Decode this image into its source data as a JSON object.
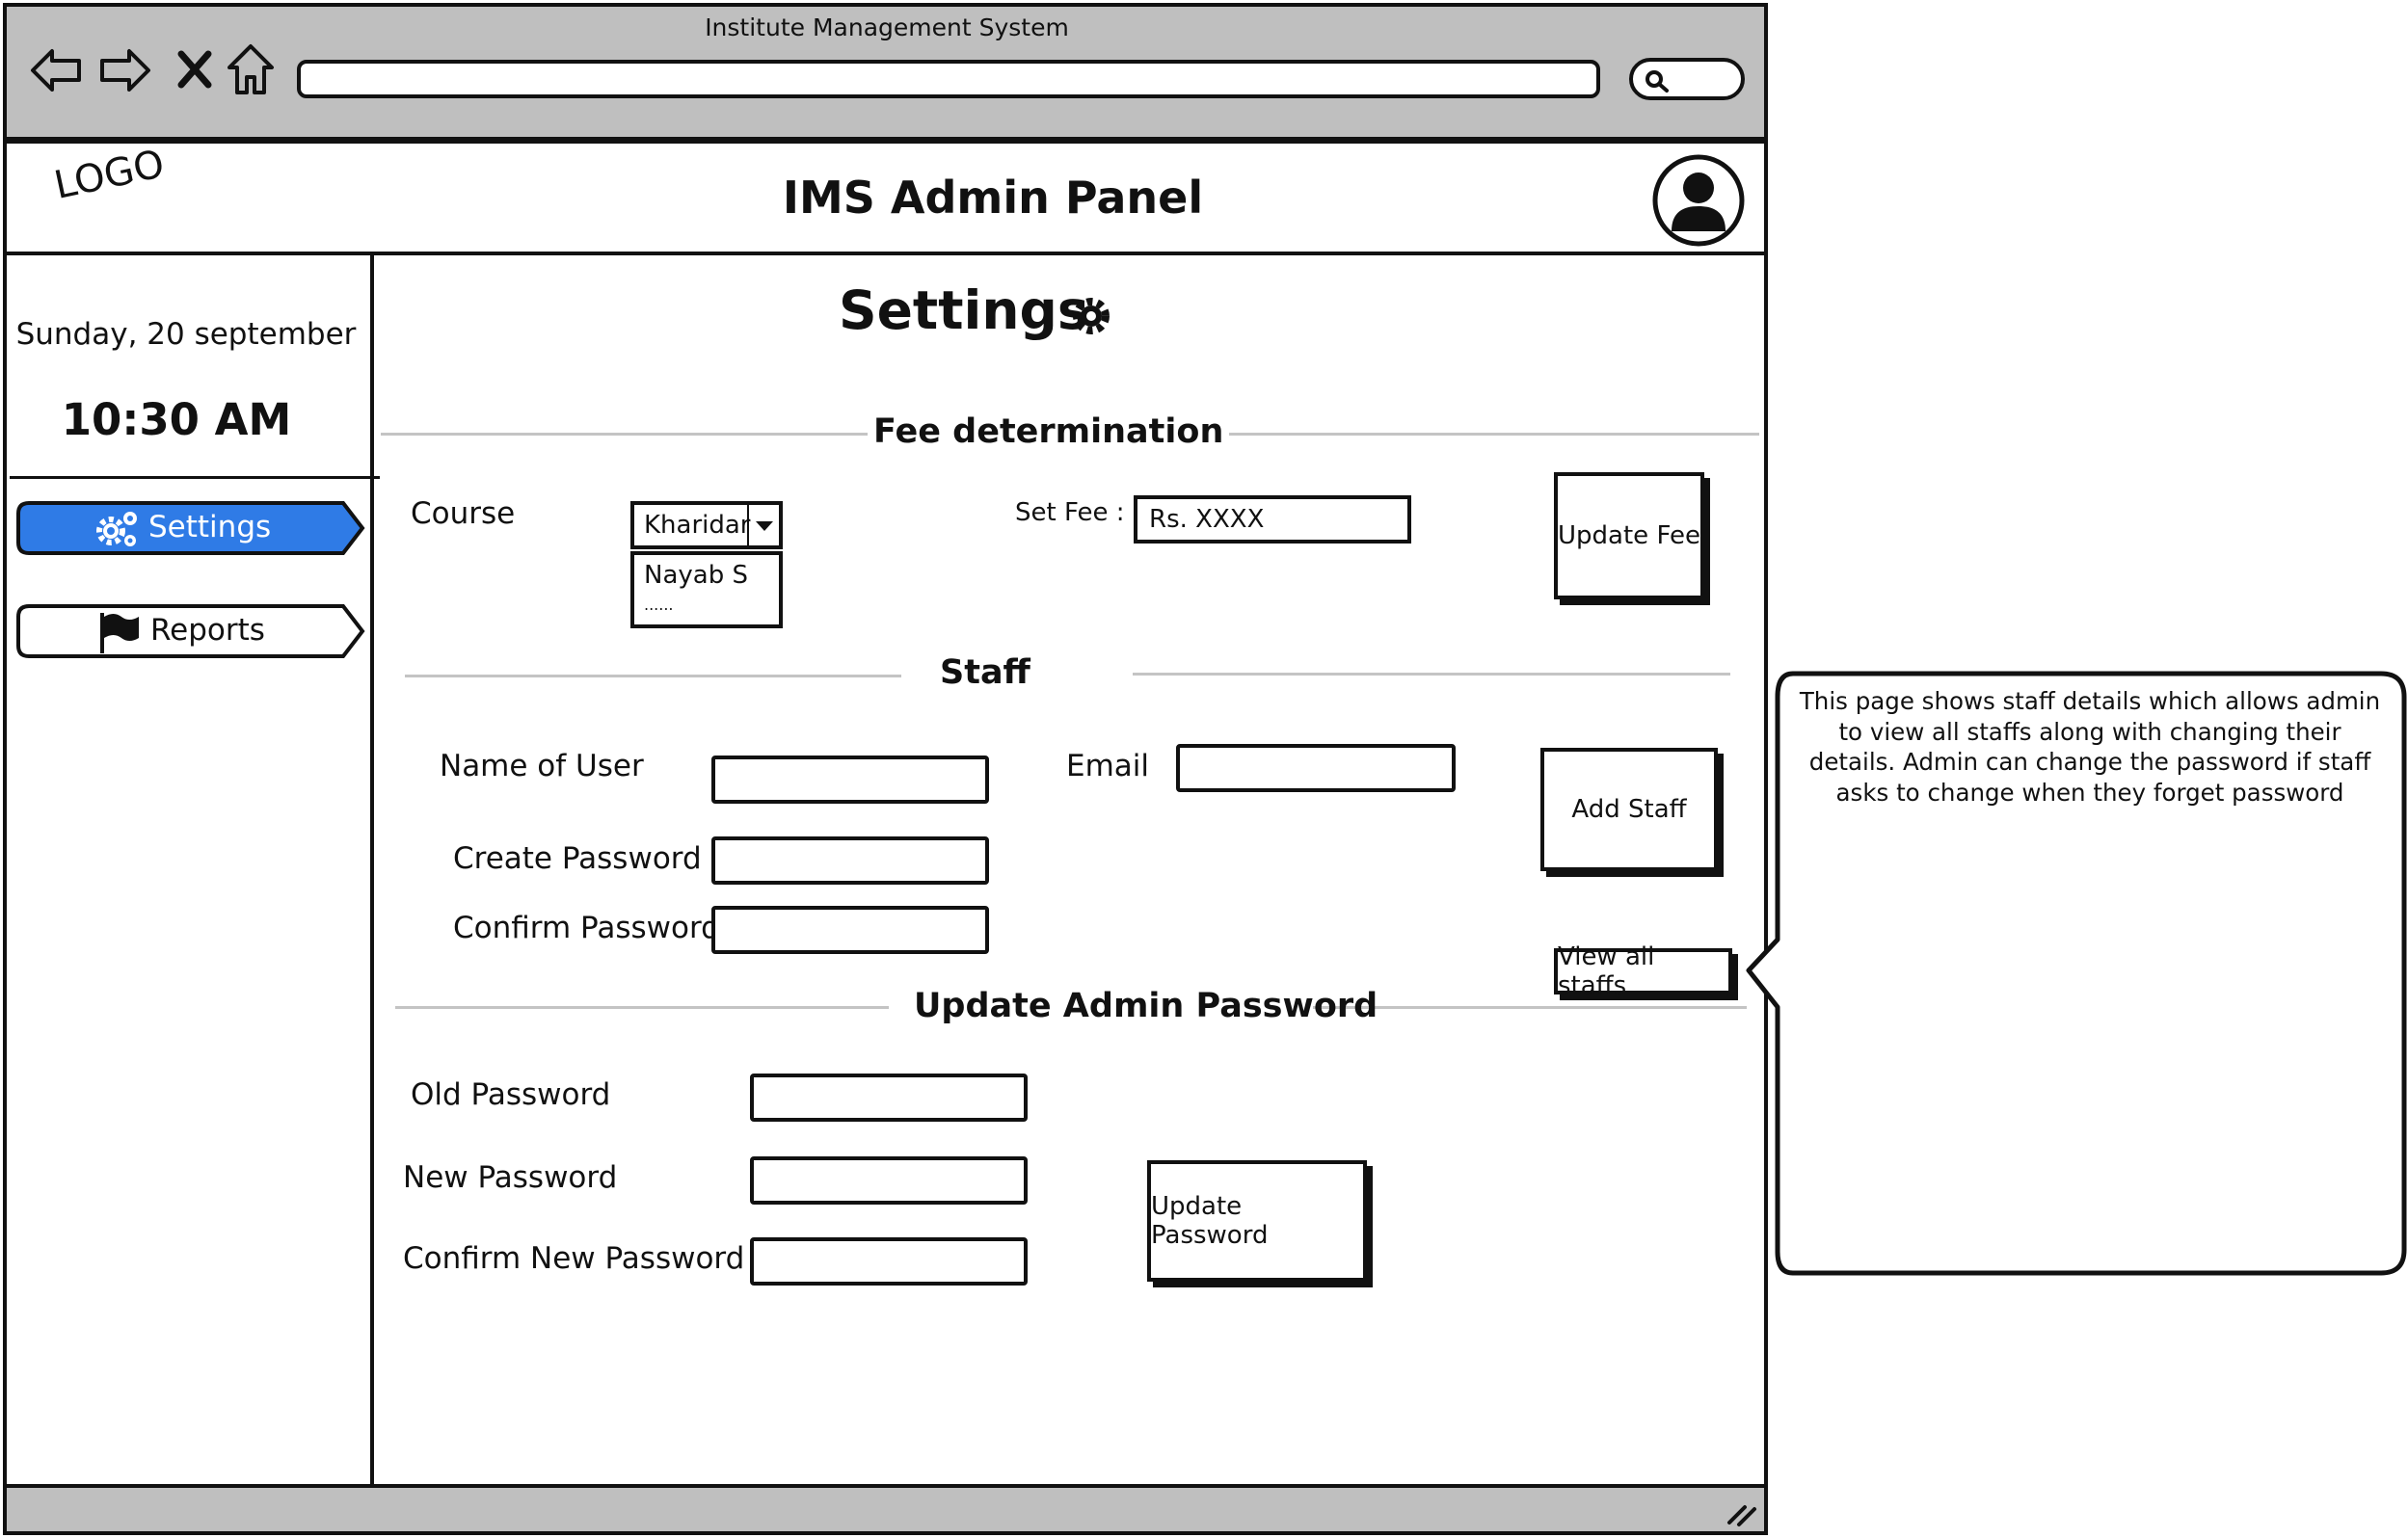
{
  "browser": {
    "title": "Institute Management System"
  },
  "header": {
    "logo": "LOGO",
    "title": "IMS Admin Panel"
  },
  "sidebar": {
    "date": "Sunday, 20 september",
    "time": "10:30 AM",
    "items": [
      {
        "label": "Settings",
        "icon": "gears-icon",
        "active": true
      },
      {
        "label": "Reports",
        "icon": "flag-icon",
        "active": false
      }
    ]
  },
  "page": {
    "title": "Settings",
    "title_icon": "gear-icon"
  },
  "fee": {
    "section_title": "Fee determination",
    "course_label": "Course",
    "course_selected": "Kharidar",
    "course_options": [
      "Nayab S",
      "......"
    ],
    "set_fee_label": "Set Fee :",
    "fee_value": "Rs. XXXX",
    "update_button": "Update Fee"
  },
  "staff": {
    "section_title": "Staff",
    "name_label": "Name of User",
    "email_label": "Email",
    "create_password_label": "Create Password",
    "confirm_password_label": "Confirm Password",
    "add_button": "Add Staff",
    "view_all_button": "View all staffs"
  },
  "admin_password": {
    "section_title": "Update Admin Password",
    "old_label": "Old Password",
    "new_label": "New Password",
    "confirm_label": "Confirm New Password",
    "update_button": "Update Password"
  },
  "note": {
    "text": "This page shows staff details which allows admin to view all staffs along with changing their details. Admin can change the password if staff asks to change when they forget password"
  },
  "colors": {
    "accent": "#2f7be6",
    "chrome": "#bfbfbf",
    "rule": "#c4c4c4"
  }
}
